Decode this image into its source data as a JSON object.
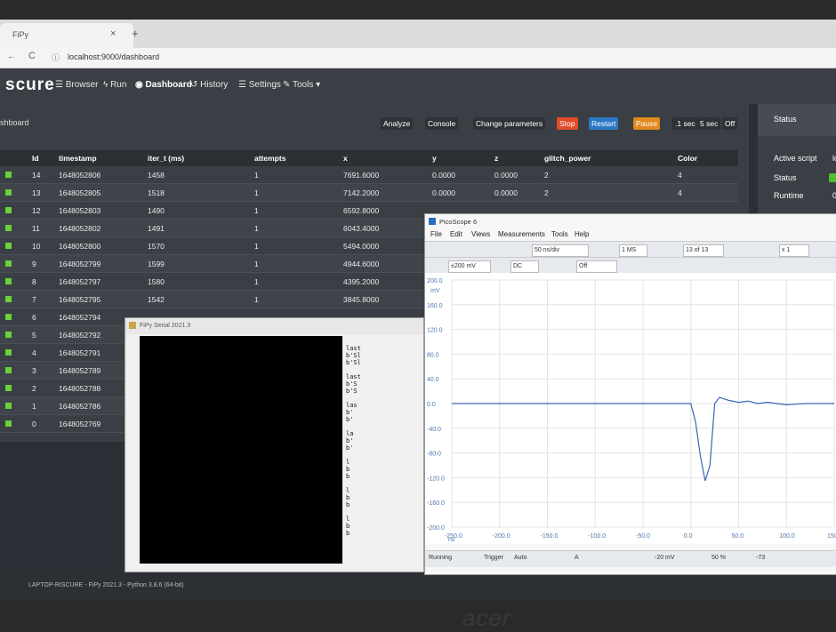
{
  "browser": {
    "tab_title": "FiPy",
    "tab_close": "×",
    "new_tab": "+",
    "url": "localhost:9000/dashboard"
  },
  "navbar": {
    "brand": "scure",
    "items": [
      "Browser",
      "Run",
      "Dashboard",
      "History",
      "Settings",
      "Tools"
    ]
  },
  "panel": {
    "breadcrumb": "shboard",
    "buttons": [
      "Analyze",
      "Console",
      "Change parameters",
      "Stop",
      "Restart",
      "Pause",
      ".1 sec",
      "5 sec",
      "Off"
    ]
  },
  "table": {
    "headers": [
      "Id",
      "timestamp",
      "iter_t (ms)",
      "attempts",
      "x",
      "y",
      "z",
      "glitch_power",
      "Color"
    ],
    "rows": [
      {
        "id": "14",
        "timestamp": "1648052806",
        "iter": "1458",
        "attempts": "1",
        "x": "7691.6000",
        "y": "0.0000",
        "z": "0.0000",
        "gp": "2",
        "color": "4"
      },
      {
        "id": "13",
        "timestamp": "1648052805",
        "iter": "1518",
        "attempts": "1",
        "x": "7142.2000",
        "y": "0.0000",
        "z": "0.0000",
        "gp": "2",
        "color": "4"
      },
      {
        "id": "12",
        "timestamp": "1648052803",
        "iter": "1490",
        "attempts": "1",
        "x": "6592.8000",
        "y": "",
        "z": "",
        "gp": "",
        "color": ""
      },
      {
        "id": "11",
        "timestamp": "1648052802",
        "iter": "1491",
        "attempts": "1",
        "x": "6043.4000",
        "y": "",
        "z": "",
        "gp": "",
        "color": ""
      },
      {
        "id": "10",
        "timestamp": "1648052800",
        "iter": "1570",
        "attempts": "1",
        "x": "5494.0000",
        "y": "",
        "z": "",
        "gp": "",
        "color": ""
      },
      {
        "id": "9",
        "timestamp": "1648052799",
        "iter": "1599",
        "attempts": "1",
        "x": "4944.6000",
        "y": "",
        "z": "",
        "gp": "",
        "color": ""
      },
      {
        "id": "8",
        "timestamp": "1648052797",
        "iter": "1580",
        "attempts": "1",
        "x": "4395.2000",
        "y": "",
        "z": "",
        "gp": "",
        "color": ""
      },
      {
        "id": "7",
        "timestamp": "1648052795",
        "iter": "1542",
        "attempts": "1",
        "x": "3845.8000",
        "y": "",
        "z": "",
        "gp": "",
        "color": ""
      },
      {
        "id": "6",
        "timestamp": "1648052794",
        "iter": "",
        "attempts": "",
        "x": "",
        "y": "",
        "z": "",
        "gp": "",
        "color": ""
      },
      {
        "id": "5",
        "timestamp": "1648052792",
        "iter": "",
        "attempts": "",
        "x": "",
        "y": "",
        "z": "",
        "gp": "",
        "color": ""
      },
      {
        "id": "4",
        "timestamp": "1648052791",
        "iter": "",
        "attempts": "",
        "x": "",
        "y": "",
        "z": "",
        "gp": "",
        "color": ""
      },
      {
        "id": "3",
        "timestamp": "1648052789",
        "iter": "",
        "attempts": "",
        "x": "",
        "y": "",
        "z": "",
        "gp": "",
        "color": ""
      },
      {
        "id": "2",
        "timestamp": "1648052788",
        "iter": "",
        "attempts": "",
        "x": "",
        "y": "",
        "z": "",
        "gp": "",
        "color": ""
      },
      {
        "id": "1",
        "timestamp": "1648052786",
        "iter": "",
        "attempts": "",
        "x": "",
        "y": "",
        "z": "",
        "gp": "",
        "color": ""
      },
      {
        "id": "0",
        "timestamp": "1648052769",
        "iter": "",
        "attempts": "",
        "x": "",
        "y": "",
        "z": "",
        "gp": "",
        "color": ""
      }
    ]
  },
  "status": {
    "title": "Status",
    "rows": [
      {
        "label": "Active script",
        "value": "lo"
      },
      {
        "label": "Status",
        "value": ""
      },
      {
        "label": "Runtime",
        "value": "0"
      }
    ]
  },
  "footer": "LAPTOP-RISCURE - FiPy 2021.3 - Python 3.8.6 (64-bit)",
  "serial": {
    "title": "FiPy Serial 2021.3",
    "lines": [
      "last",
      "b'Sl",
      "b'Sl",
      "",
      "last",
      "b'S",
      "b'S",
      "",
      "las",
      "b'",
      "b'",
      "",
      "la",
      "b'",
      "b'",
      "",
      "l",
      "b",
      "b",
      "",
      "l",
      "b",
      "b",
      "",
      "l",
      "b",
      "b"
    ]
  },
  "picoscope": {
    "title": "PicoScope 6",
    "menu": [
      "File",
      "Edit",
      "Views",
      "Measurements",
      "Tools",
      "Help"
    ],
    "toolbar1": [
      "50 ns/div",
      "1 MS",
      "13 of 13",
      "x 1"
    ],
    "toolbar2": [
      "±200 mV",
      "DC",
      "Off"
    ],
    "unit": "mV",
    "bottom": [
      "Running",
      "Trigger",
      "Auto",
      "A",
      "-20 mV",
      "50 %",
      "-73"
    ],
    "colors": {
      "trace": "#3a66b6",
      "axis": "#4a77b0"
    }
  },
  "chart_data": {
    "type": "line",
    "xlabel": "ns",
    "ylabel": "mV",
    "xlim": [
      -250,
      150
    ],
    "ylim": [
      -200,
      200
    ],
    "x_ticks": [
      "-250.0",
      "-200.0",
      "-150.0",
      "-100.0",
      "-50.0",
      "0.0",
      "50.0",
      "100.0",
      "150.0"
    ],
    "y_ticks": [
      "200.0",
      "160.0",
      "120.0",
      "80.0",
      "40.0",
      "0.0",
      "-40.0",
      "-80.0",
      "-120.0",
      "-160.0",
      "-200.0"
    ],
    "series": [
      {
        "x": [
          -250,
          -100,
          0,
          5,
          10,
          15,
          20,
          25,
          30,
          40,
          50,
          60,
          70,
          80,
          100,
          120,
          150
        ],
        "y": [
          0,
          0,
          0,
          -30,
          -85,
          -125,
          -100,
          0,
          10,
          5,
          2,
          4,
          0,
          2,
          -2,
          0,
          0
        ]
      }
    ]
  },
  "brand_logo": "acer"
}
